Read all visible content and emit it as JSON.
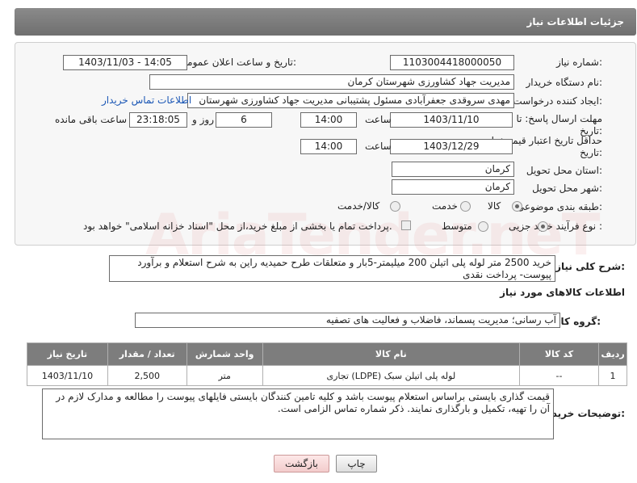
{
  "header": {
    "title": "جزئیات اطلاعات نیاز"
  },
  "fields": {
    "need_number_label": "شماره نیاز:",
    "need_number": "1103004418000050",
    "announce_label": "تاریخ و ساعت اعلان عمومی:",
    "announce_value": "1403/11/03 - 14:05",
    "buyer_org_label": "نام دستگاه خریدار:",
    "buyer_org": "مدیریت جهاد کشاورزی شهرستان کرمان",
    "creator_label": "ایجاد کننده درخواست:",
    "creator": "مهدی سروقدی جعفرآبادی مسئول پشتیبانی مدیریت جهاد کشاورزی شهرستان",
    "contact_link": "اطلاعات تماس خریدار",
    "deadline_label": "مهلت ارسال پاسخ: تا",
    "deadline_label2": "تاریخ:",
    "deadline_date": "1403/11/10",
    "time_label": "ساعت",
    "deadline_time": "14:00",
    "days": "6",
    "days_label": "روز و",
    "remaining_time": "23:18:05",
    "remaining_label": "ساعت باقی مانده",
    "validity_label": "حداقل تاریخ اعتبار قیمت: تا",
    "validity_label2": "تاریخ:",
    "validity_date": "1403/12/29",
    "validity_time": "14:00",
    "province_label": "استان محل تحویل:",
    "province": "کرمان",
    "city_label": "شهر محل تحویل:",
    "city": "کرمان",
    "category_label": "طبقه بندی موضوعی:",
    "cat_goods": "کالا",
    "cat_service": "خدمت",
    "cat_both": "کالا/خدمت",
    "process_label": "نوع فرآیند خرید :",
    "proc_partial": "جزیی",
    "proc_medium": "متوسط",
    "treasury_note": "پرداخت تمام یا بخشی از مبلغ خرید،از محل \"اسناد خزانه اسلامی\" خواهد بود."
  },
  "description": {
    "label": "شرح کلی نیاز:",
    "text": "خرید 2500 متر لوله پلی اتیلن 200 میلیمتر-5بار و متعلقات طرح حمیدیه راین به شرح استعلام و برآورد پیوست- پرداخت نقدی"
  },
  "goods_info_title": "اطلاعات کالاهای مورد نیاز",
  "goods_group": {
    "label": "گروه کالا:",
    "value": "آب رسانی؛ مدیریت پسماند، فاضلاب و فعالیت های تصفیه"
  },
  "table": {
    "headers": [
      "ردیف",
      "کد کالا",
      "نام کالا",
      "واحد شمارش",
      "تعداد / مقدار",
      "تاریخ نیاز"
    ],
    "rows": [
      [
        "1",
        "--",
        "لوله پلی اتیلن سبک (LDPE) تجاری",
        "متر",
        "2,500",
        "1403/11/10"
      ]
    ]
  },
  "buyer_notes": {
    "label": "توضیحات خریدار:",
    "text": "قیمت گذاری بایستی براساس استعلام پیوست باشد و کلیه تامین کنندگان بایستی فایلهای پیوست را مطالعه و مدارک لازم در آن را تهیه، تکمیل و بارگذاری نمایند. ذکر شماره تماس الزامی است."
  },
  "buttons": {
    "print": "چاپ",
    "back": "بازگشت"
  },
  "watermark": "AriaTender.neT"
}
